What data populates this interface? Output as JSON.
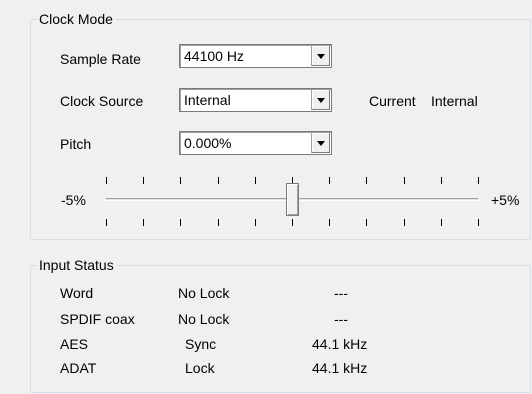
{
  "clock_mode": {
    "title": "Clock Mode",
    "sample_rate": {
      "label": "Sample Rate",
      "value": "44100 Hz"
    },
    "clock_source": {
      "label": "Clock Source",
      "value": "Internal",
      "status_label": "Current",
      "status_value": "Internal"
    },
    "pitch": {
      "label": "Pitch",
      "value": "0.000%",
      "min_label": "-5%",
      "max_label": "+5%",
      "slider_fraction": 0.5
    }
  },
  "input_status": {
    "title": "Input Status",
    "rows": [
      {
        "name": "Word",
        "state": "No Lock",
        "rate": "---"
      },
      {
        "name": "SPDIF coax",
        "state": "No Lock",
        "rate": "---"
      },
      {
        "name": "AES",
        "state": "Sync",
        "rate": "44.1 kHz"
      },
      {
        "name": "ADAT",
        "state": "Lock",
        "rate": "44.1 kHz"
      }
    ]
  }
}
